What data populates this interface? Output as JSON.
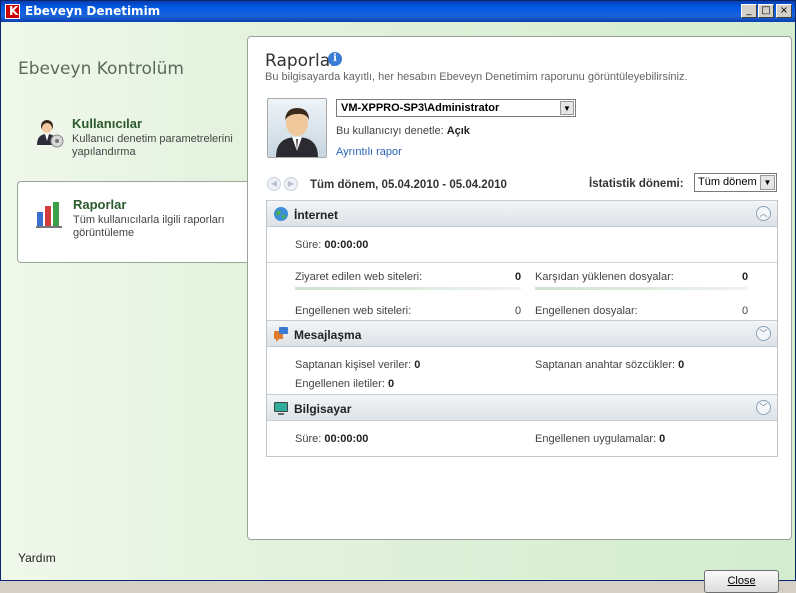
{
  "window": {
    "title": "Ebeveyn Denetimim",
    "controls": [
      "minimize",
      "maximize",
      "close"
    ]
  },
  "sidebar": {
    "title": "Ebeveyn Kontrolüm",
    "items": [
      {
        "label": "Kullanıcılar",
        "desc": "Kullanıcı denetim parametrelerini yapılandırma",
        "icon": "users-icon"
      },
      {
        "label": "Raporlar",
        "desc": "Tüm kullanıcılarla ilgili raporları görüntüleme",
        "icon": "reports-chart-icon",
        "selected": true
      }
    ],
    "help": "Yardım"
  },
  "reports": {
    "title": "Raporlar",
    "subtitle": "Bu bilgisayarda kayıtlı, her hesabın Ebeveyn Denetimim raporunu görüntüleyebilirsiniz.",
    "user_select": "VM-XPPRO-SP3\\Administrator",
    "control_label": "Bu kullanıcıyı denetle:",
    "control_value": "Açık",
    "detail_link": "Ayrıntılı rapor",
    "period": "Tüm dönem, 05.04.2010 - 05.04.2010",
    "stat_period_label": "İstatistik dönemi:",
    "stat_period_value": "Tüm dönem"
  },
  "sections": {
    "internet": {
      "title": "İnternet",
      "duration_label": "Süre:",
      "duration_value": "00:00:00",
      "visited_label": "Ziyaret edilen web siteleri:",
      "visited_value": "0",
      "downloaded_label": "Karşıdan yüklenen dosyalar:",
      "downloaded_value": "0",
      "blocked_sites_label": "Engellenen web siteleri:",
      "blocked_sites_value": "0",
      "blocked_files_label": "Engellenen dosyalar:",
      "blocked_files_value": "0"
    },
    "messaging": {
      "title": "Mesajlaşma",
      "personal_label": "Saptanan kişisel veriler:",
      "personal_value": "0",
      "keywords_label": "Saptanan anahtar sözcükler:",
      "keywords_value": "0",
      "blocked_msgs_label": "Engellenen iletiler:",
      "blocked_msgs_value": "0"
    },
    "computer": {
      "title": "Bilgisayar",
      "duration_label": "Süre:",
      "duration_value": "00:00:00",
      "blocked_apps_label": "Engellenen uygulamalar:",
      "blocked_apps_value": "0"
    }
  },
  "footer": {
    "close_label": "Close"
  },
  "colors": {
    "title_bar": "#0058e6",
    "sidebar_bg": "#e4f2de",
    "link": "#2a62b8",
    "nav_label": "#2b5a2e"
  }
}
